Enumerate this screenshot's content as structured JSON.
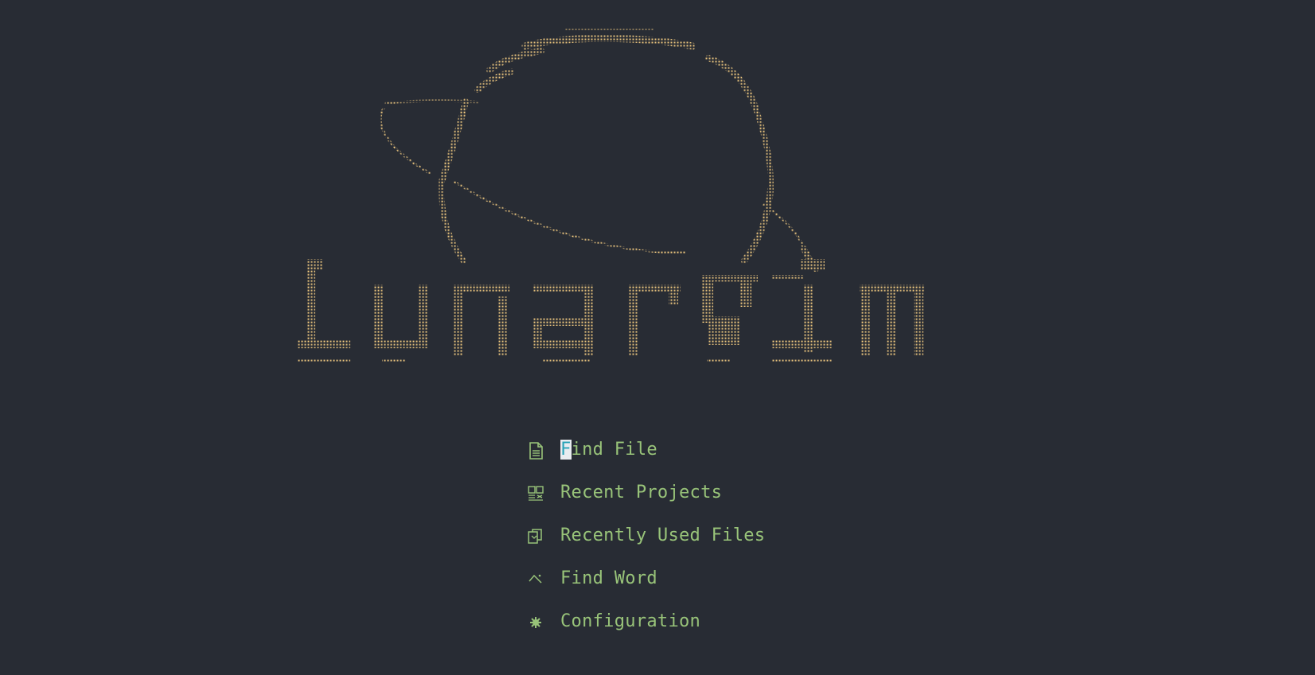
{
  "app": {
    "logo_text": "LunarVim",
    "logo_color": "#e5c07b",
    "background": "#282c34",
    "accent": "#98c379"
  },
  "menu": {
    "items": [
      {
        "icon": "file-icon",
        "label_first": "F",
        "label_rest": "ind File"
      },
      {
        "icon": "projects-icon",
        "label": "Recent Projects"
      },
      {
        "icon": "recent-files-icon",
        "label": "Recently Used Files"
      },
      {
        "icon": "find-word-icon",
        "label": "Find Word"
      },
      {
        "icon": "gear-icon",
        "label": "Configuration"
      }
    ]
  }
}
